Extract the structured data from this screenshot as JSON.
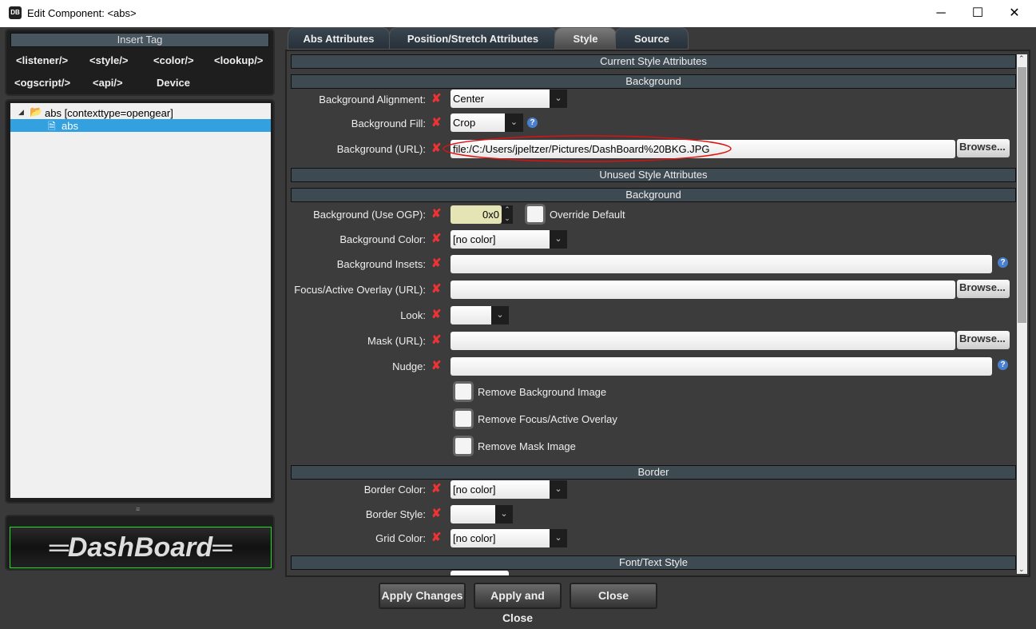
{
  "window": {
    "title": "Edit Component: <abs>",
    "icon": "DB",
    "minimize": "─",
    "maximize": "☐",
    "close": "✕"
  },
  "insert_tag": {
    "header": "Insert Tag",
    "tags": [
      "<listener/>",
      "<style/>",
      "<color/>",
      "<lookup/>",
      "<ogscript/>",
      "<api/>",
      "Device"
    ]
  },
  "tree": {
    "root": "abs [contexttype=opengear]",
    "child": "abs"
  },
  "logo": {
    "text": "DashBoard"
  },
  "tabs": [
    "Abs Attributes",
    "Position/Stretch Attributes",
    "Style",
    "Source"
  ],
  "active_tab": "Style",
  "sections": {
    "current": "Current Style Attributes",
    "background1": "Background",
    "unused": "Unused Style Attributes",
    "background2": "Background",
    "border": "Border",
    "font": "Font/Text Style"
  },
  "fields": {
    "bg_alignment": {
      "label": "Background Alignment:",
      "value": "Center"
    },
    "bg_fill": {
      "label": "Background Fill:",
      "value": "Crop"
    },
    "bg_url": {
      "label": "Background (URL):",
      "value": "file:/C:/Users/jpeltzer/Pictures/DashBoard%20BKG.JPG"
    },
    "bg_ogp": {
      "label": "Background (Use OGP):",
      "value": "0x0",
      "override_label": "Override Default"
    },
    "bg_color": {
      "label": "Background Color:",
      "value": "[no color]"
    },
    "bg_insets": {
      "label": "Background Insets:",
      "value": ""
    },
    "focus_overlay": {
      "label": "Focus/Active Overlay (URL):",
      "value": ""
    },
    "look": {
      "label": "Look:",
      "value": ""
    },
    "mask": {
      "label": "Mask (URL):",
      "value": ""
    },
    "nudge": {
      "label": "Nudge:",
      "value": ""
    },
    "remove_bg": {
      "label": "Remove Background Image"
    },
    "remove_focus": {
      "label": "Remove Focus/Active Overlay"
    },
    "remove_mask": {
      "label": "Remove Mask Image"
    },
    "border_color": {
      "label": "Border Color:",
      "value": "[no color]"
    },
    "border_style": {
      "label": "Border Style:",
      "value": ""
    },
    "grid_color": {
      "label": "Grid Color:",
      "value": "[no color]"
    }
  },
  "browse_label": "Browse...",
  "remove_glyph": "✘",
  "help_glyph": "?",
  "buttons": {
    "apply_changes": "Apply Changes",
    "apply_close": "Apply and Close",
    "close": "Close"
  },
  "colors": {
    "remove": "#e33333",
    "selection": "#33a0e0",
    "annotation": "#e01010"
  }
}
